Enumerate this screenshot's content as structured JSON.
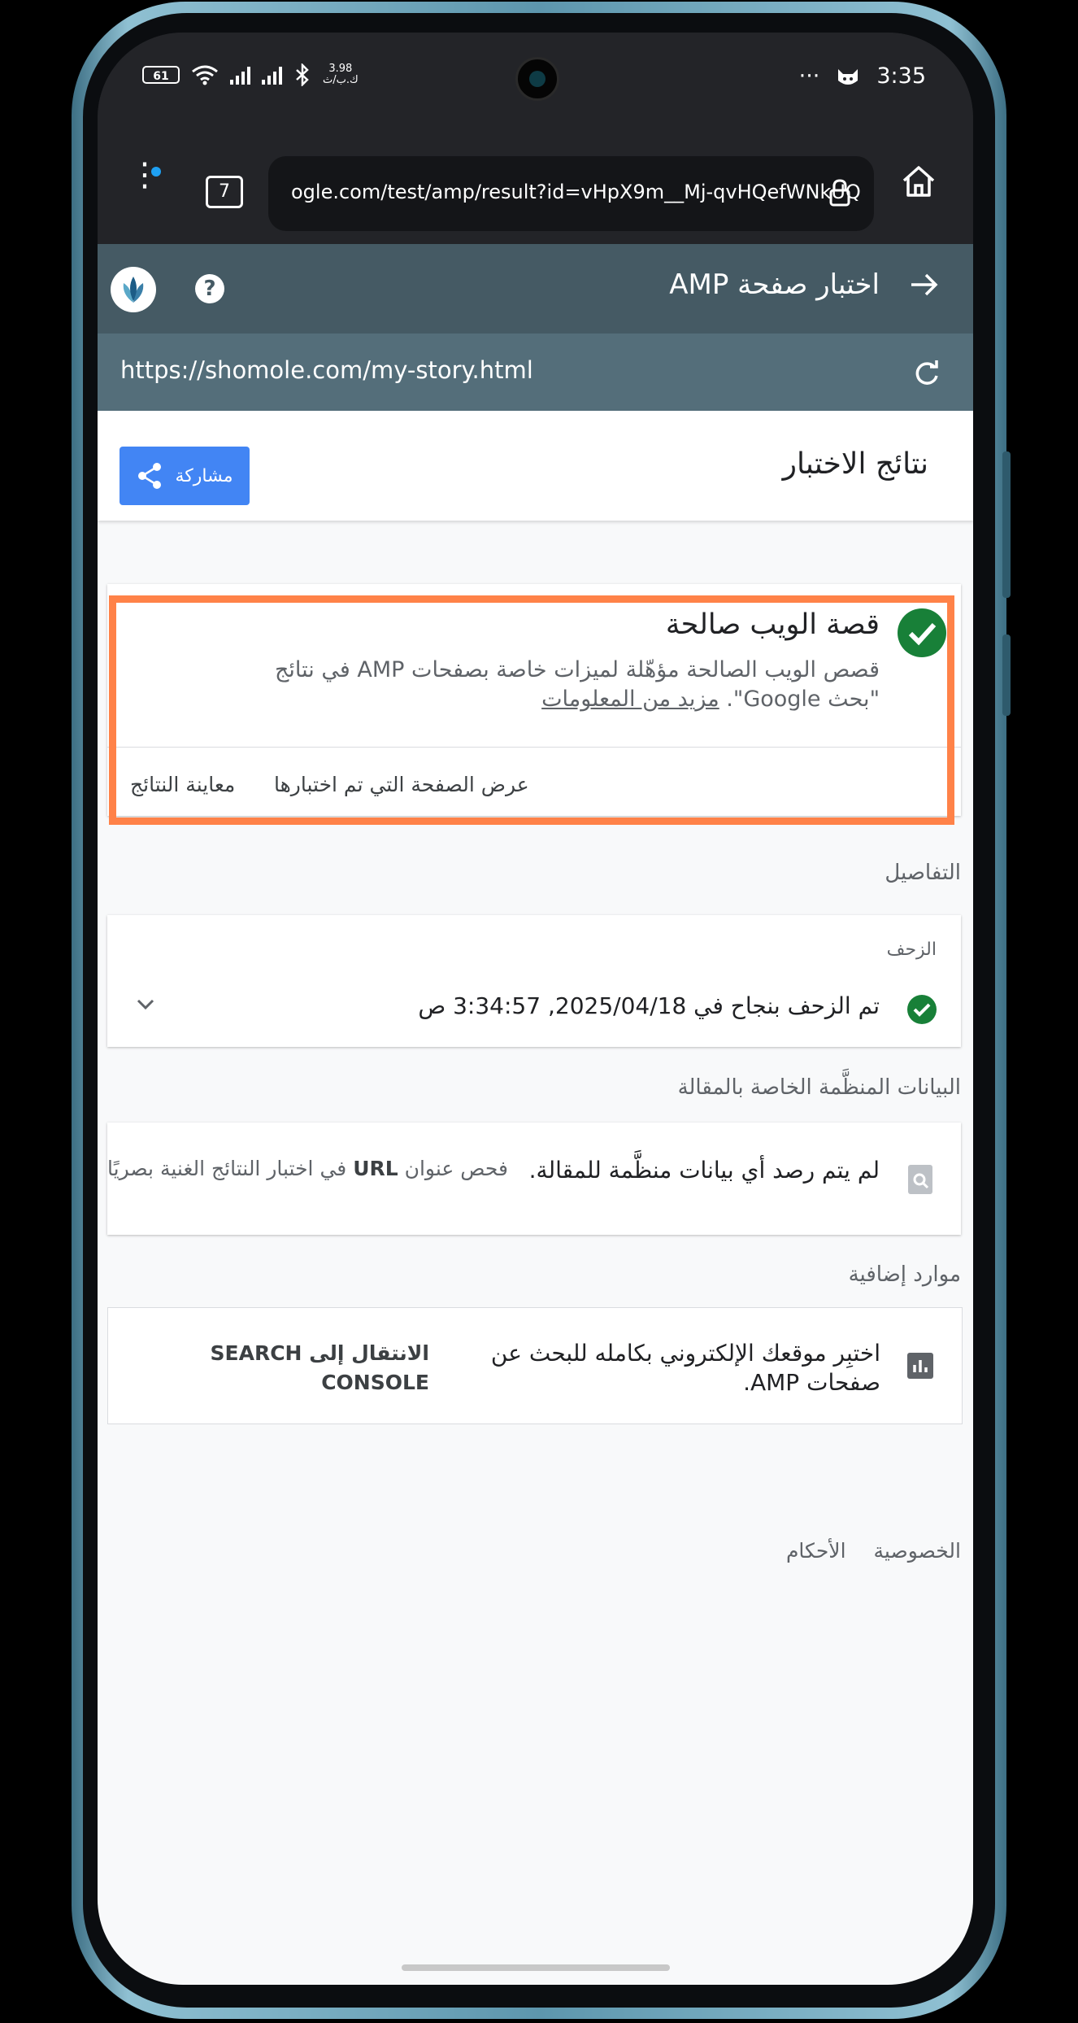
{
  "status_bar": {
    "battery": "61",
    "net_speed": "3.98",
    "net_speed_unit": "ك.ب/ث",
    "more": "···",
    "time": "3:35"
  },
  "browser": {
    "tab_count": "7",
    "url": "ogle.com/test/amp/result?id=vHpX9m__Mj-qvHQefWNkUQ"
  },
  "app_bar": {
    "title": "اختبار صفحة AMP",
    "help": "?"
  },
  "tested_url": "https://shomole.com/my-story.html",
  "results": {
    "title": "نتائج الاختبار",
    "share": "مشاركة"
  },
  "valid_card": {
    "title": "قصة الويب صالحة",
    "desc": "قصص الويب الصالحة مؤهّلة لميزات خاصة بصفحات AMP في نتائج \"بحث Google\". ",
    "learn_more": "مزيد من المعلومات",
    "view_tested": "عرض الصفحة التي تم اختبارها",
    "preview": "معاينة النتائج"
  },
  "details_label": "التفاصيل",
  "crawl": {
    "label": "الزحف",
    "status": "تم الزحف بنجاح في 2025/04/18, 3:34:57 ص"
  },
  "structured_label": "البيانات المنظَّمة الخاصة بالمقالة",
  "structured": {
    "text": "لم يتم رصد أي بيانات منظَّمة للمقالة.",
    "check_prefix": "فحص عنوان ",
    "check_url": "URL",
    "check_suffix": " في اختبار النتائج الغنية بصريًا"
  },
  "resources_label": "موارد إضافية",
  "resources": {
    "text": "اختبِر موقعك الإلكتروني بكامله للبحث عن صفحات AMP.",
    "link_prefix": "الانتقال إلى ",
    "link_name": "SEARCH CONSOLE"
  },
  "footer": {
    "privacy": "الخصوصية",
    "terms": "الأحكام"
  },
  "colors": {
    "app_bar": "#455a64",
    "url_row": "#546e7a",
    "share_button": "#4285f4",
    "success": "#188038",
    "annotation": "#ff8248"
  }
}
